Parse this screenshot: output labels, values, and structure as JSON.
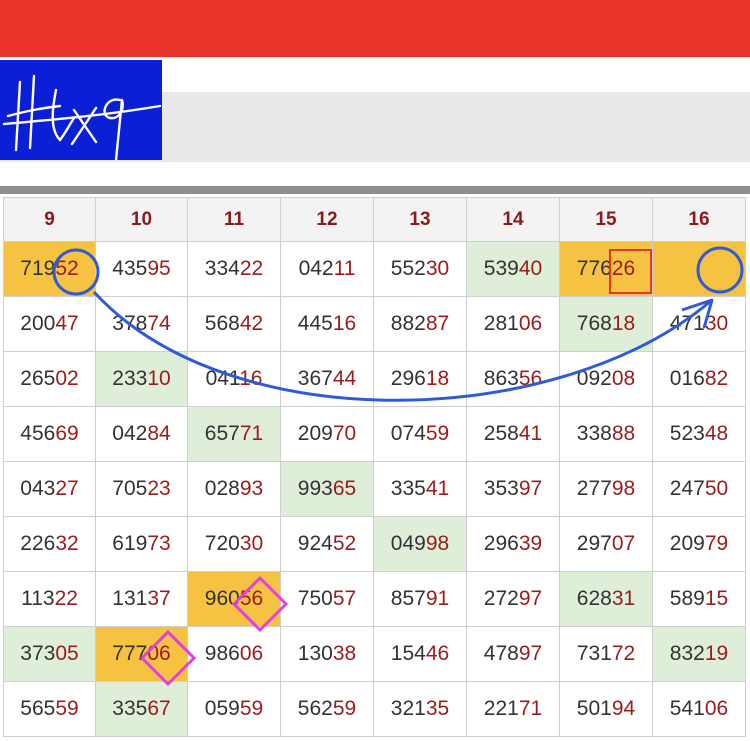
{
  "logo_signature_text": "Hlxq",
  "columns": [
    "9",
    "10",
    "11",
    "12",
    "13",
    "14",
    "15",
    "16"
  ],
  "rows": [
    [
      {
        "v": "71952",
        "h": "o"
      },
      {
        "v": "43595"
      },
      {
        "v": "33422"
      },
      {
        "v": "04211"
      },
      {
        "v": "55230"
      },
      {
        "v": "53940",
        "h": "g"
      },
      {
        "v": "77626",
        "h": "o"
      },
      {
        "v": "",
        "h": "o"
      }
    ],
    [
      {
        "v": "20047"
      },
      {
        "v": "37874"
      },
      {
        "v": "56842"
      },
      {
        "v": "44516"
      },
      {
        "v": "88287"
      },
      {
        "v": "28106"
      },
      {
        "v": "76818",
        "h": "g"
      },
      {
        "v": "47130"
      }
    ],
    [
      {
        "v": "26502"
      },
      {
        "v": "23310",
        "h": "g"
      },
      {
        "v": "04116"
      },
      {
        "v": "36744"
      },
      {
        "v": "29618"
      },
      {
        "v": "86356"
      },
      {
        "v": "09208"
      },
      {
        "v": "01682"
      }
    ],
    [
      {
        "v": "45669"
      },
      {
        "v": "04284"
      },
      {
        "v": "65771",
        "h": "g"
      },
      {
        "v": "20970"
      },
      {
        "v": "07459"
      },
      {
        "v": "25841"
      },
      {
        "v": "33888"
      },
      {
        "v": "52348"
      }
    ],
    [
      {
        "v": "04327"
      },
      {
        "v": "70523"
      },
      {
        "v": "02893"
      },
      {
        "v": "99365",
        "h": "g"
      },
      {
        "v": "33541"
      },
      {
        "v": "35397"
      },
      {
        "v": "27798"
      },
      {
        "v": "24750"
      }
    ],
    [
      {
        "v": "22632"
      },
      {
        "v": "61973"
      },
      {
        "v": "72030"
      },
      {
        "v": "92452"
      },
      {
        "v": "04998",
        "h": "g"
      },
      {
        "v": "29639"
      },
      {
        "v": "29707"
      },
      {
        "v": "20979"
      }
    ],
    [
      {
        "v": "11322"
      },
      {
        "v": "13137"
      },
      {
        "v": "96056",
        "h": "o"
      },
      {
        "v": "75057"
      },
      {
        "v": "85791"
      },
      {
        "v": "27297"
      },
      {
        "v": "62831",
        "h": "g"
      },
      {
        "v": "58915"
      }
    ],
    [
      {
        "v": "37305",
        "h": "g"
      },
      {
        "v": "77706",
        "h": "o"
      },
      {
        "v": "98606"
      },
      {
        "v": "13038"
      },
      {
        "v": "15446"
      },
      {
        "v": "47897"
      },
      {
        "v": "73172"
      },
      {
        "v": "83219",
        "h": "g"
      }
    ],
    [
      {
        "v": "56559"
      },
      {
        "v": "33567",
        "h": "g"
      },
      {
        "v": "05959"
      },
      {
        "v": "56259"
      },
      {
        "v": "32135"
      },
      {
        "v": "22171"
      },
      {
        "v": "50194"
      },
      {
        "v": "54106"
      }
    ]
  ],
  "colors": {
    "accent_red": "#e8342a",
    "logo_blue": "#0b1fd6",
    "highlight_orange": "#f6c242",
    "highlight_green": "#dfeed8",
    "digit_red": "#9b1c1c",
    "annotation_blue": "#2f5bd8",
    "annotation_magenta": "#e040e0",
    "annotation_red_box": "#e8342a"
  }
}
